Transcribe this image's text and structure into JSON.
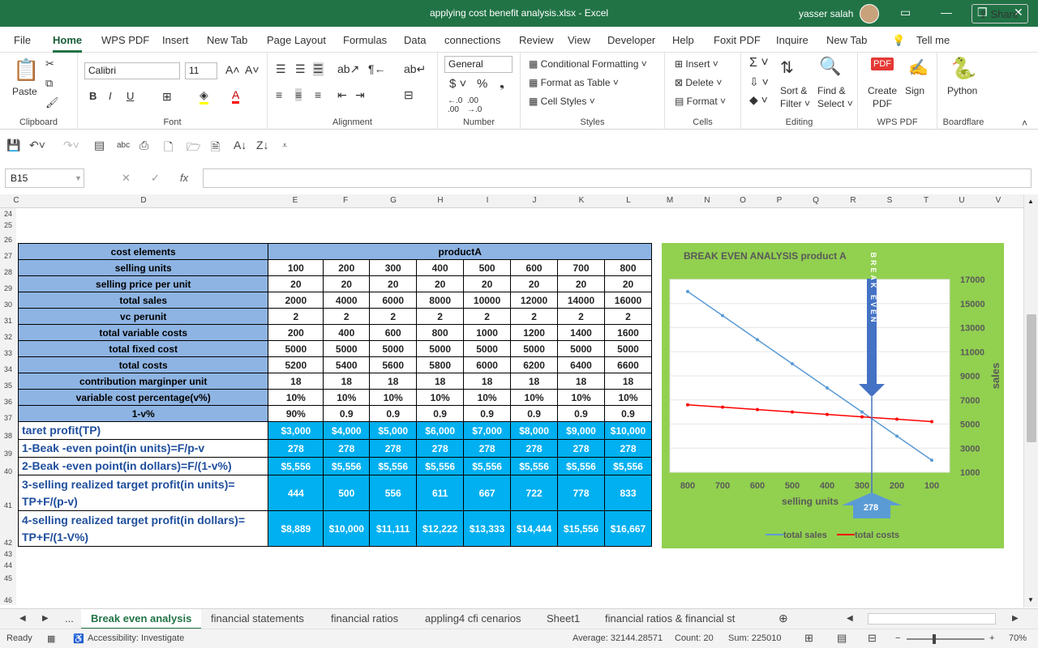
{
  "window": {
    "title": "applying cost benefit analysis.xlsx  -  Excel",
    "user": "yasser salah"
  },
  "menu": [
    "File",
    "Home",
    "WPS PDF",
    "Insert",
    "New Tab",
    "Page Layout",
    "Formulas",
    "Data",
    "connections",
    "Review",
    "View",
    "Developer",
    "Help",
    "Foxit PDF",
    "Inquire",
    "New Tab",
    "Tell me"
  ],
  "share": "Share",
  "ribbon": {
    "paste": "Paste",
    "clipboard": "Clipboard",
    "font_name": "Calibri",
    "font_size": "11",
    "font": "Font",
    "alignment": "Alignment",
    "number_format": "General",
    "number": "Number",
    "cond_fmt": "Conditional Formatting",
    "fmt_table": "Format as Table",
    "cell_styles": "Cell Styles",
    "styles": "Styles",
    "insert": "Insert",
    "delete": "Delete",
    "format": "Format",
    "cells": "Cells",
    "sort": "Sort &",
    "filter": "Filter",
    "find": "Find &",
    "select": "Select",
    "editing": "Editing",
    "create": "Create",
    "pdf": "PDF",
    "sign": "Sign",
    "wps": "WPS PDF",
    "python": "Python",
    "boardflare": "Boardflare"
  },
  "namebox": "B15",
  "columns": [
    "C",
    "D",
    "E",
    "F",
    "G",
    "H",
    "I",
    "J",
    "K",
    "L",
    "M",
    "N",
    "O",
    "P",
    "Q",
    "R",
    "S",
    "T",
    "U",
    "V"
  ],
  "rows": [
    "24",
    "25",
    "26",
    "27",
    "28",
    "29",
    "30",
    "31",
    "32",
    "33",
    "34",
    "35",
    "36",
    "37",
    "38",
    "39",
    "40",
    "41",
    "42",
    "43",
    "44",
    "45",
    "46"
  ],
  "table": {
    "header_label": "cost elements",
    "header_product": "productA",
    "rows": [
      {
        "label": "selling units",
        "values": [
          "100",
          "200",
          "300",
          "400",
          "500",
          "600",
          "700",
          "800"
        ]
      },
      {
        "label": "selling price per unit",
        "values": [
          "20",
          "20",
          "20",
          "20",
          "20",
          "20",
          "20",
          "20"
        ]
      },
      {
        "label": "total sales",
        "values": [
          "2000",
          "4000",
          "6000",
          "8000",
          "10000",
          "12000",
          "14000",
          "16000"
        ]
      },
      {
        "label": "vc perunit",
        "values": [
          "2",
          "2",
          "2",
          "2",
          "2",
          "2",
          "2",
          "2"
        ]
      },
      {
        "label": "total variable costs",
        "values": [
          "200",
          "400",
          "600",
          "800",
          "1000",
          "1200",
          "1400",
          "1600"
        ]
      },
      {
        "label": "total fixed cost",
        "values": [
          "5000",
          "5000",
          "5000",
          "5000",
          "5000",
          "5000",
          "5000",
          "5000"
        ]
      },
      {
        "label": "total costs",
        "values": [
          "5200",
          "5400",
          "5600",
          "5800",
          "6000",
          "6200",
          "6400",
          "6600"
        ]
      },
      {
        "label": "contribution marginper unit",
        "values": [
          "18",
          "18",
          "18",
          "18",
          "18",
          "18",
          "18",
          "18"
        ]
      },
      {
        "label": "variable cost  percentage(v%)",
        "values": [
          "10%",
          "10%",
          "10%",
          "10%",
          "10%",
          "10%",
          "10%",
          "10%"
        ]
      },
      {
        "label": "1-v%",
        "values": [
          "90%",
          "0.9",
          "0.9",
          "0.9",
          "0.9",
          "0.9",
          "0.9",
          "0.9"
        ]
      }
    ],
    "blue_rows": [
      {
        "label": "taret profit(TP)",
        "values": [
          "$3,000",
          "$4,000",
          "$5,000",
          "$6,000",
          "$7,000",
          "$8,000",
          "$9,000",
          "$10,000"
        ]
      },
      {
        "label": "1-Beak -even point(in units)=F/p-v",
        "values": [
          "278",
          "278",
          "278",
          "278",
          "278",
          "278",
          "278",
          "278"
        ]
      },
      {
        "label": "2-Beak -even point(in dollars)=F/(1-v%)",
        "values": [
          "$5,556",
          "$5,556",
          "$5,556",
          "$5,556",
          "$5,556",
          "$5,556",
          "$5,556",
          "$5,556"
        ]
      }
    ],
    "target_rows": [
      {
        "label": "3-selling realized target profit(in units)= TP+F/(p-v)",
        "values": [
          "444",
          "500",
          "556",
          "611",
          "667",
          "722",
          "778",
          "833"
        ]
      },
      {
        "label": "4-selling realized target profit(in dollars)= TP+F/(1-V%)",
        "values": [
          "$8,889",
          "$10,000",
          "$11,111",
          "$12,222",
          "$13,333",
          "$14,444",
          "$15,556",
          "$16,667"
        ]
      }
    ]
  },
  "chart_data": {
    "type": "line",
    "title": "BREAK EVEN  ANALYSIS product A",
    "xlabel": "selling units",
    "ylabel": "sales",
    "categories": [
      "800",
      "700",
      "600",
      "500",
      "400",
      "300",
      "200",
      "100"
    ],
    "series": [
      {
        "name": "total sales",
        "color": "#5b9bd5",
        "values": [
          16000,
          14000,
          12000,
          10000,
          8000,
          6000,
          4000,
          2000
        ]
      },
      {
        "name": "total costs",
        "color": "#ff0000",
        "values": [
          6600,
          6400,
          6200,
          6000,
          5800,
          5600,
          5400,
          5200
        ]
      }
    ],
    "yticks": [
      "1000",
      "3000",
      "5000",
      "7000",
      "9000",
      "11000",
      "13000",
      "15000",
      "17000"
    ],
    "ylim": [
      1000,
      17000
    ],
    "annotation_top": "BREAK EVEN",
    "annotation_bottom": "278"
  },
  "sheets": [
    "...",
    "Break even analysis",
    "financial statements",
    "financial ratios",
    "appling4 cfi cenarios",
    "Sheet1",
    "financial ratios & financial st"
  ],
  "status": {
    "ready": "Ready",
    "access": "Accessibility: Investigate",
    "average": "Average: 32144.28571",
    "count": "Count: 20",
    "sum": "Sum: 225010",
    "zoom": "70%"
  }
}
